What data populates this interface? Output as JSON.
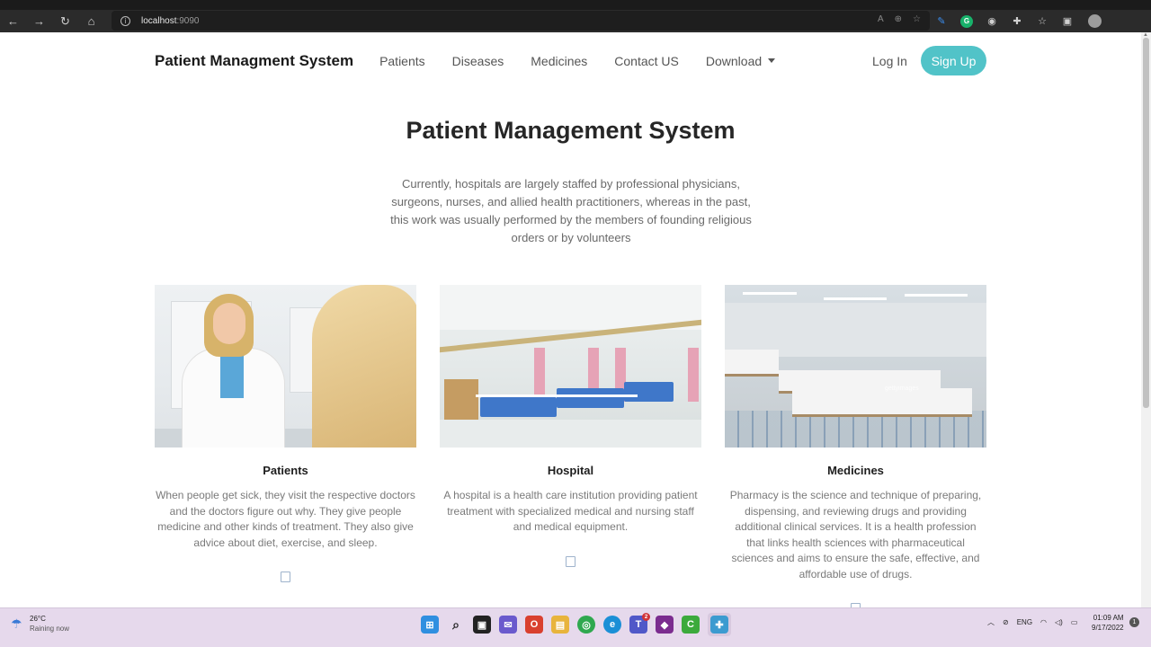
{
  "browser": {
    "url_host": "localhost",
    "url_port": ":9090"
  },
  "navbar": {
    "brand": "Patient Managment System",
    "links": [
      "Patients",
      "Diseases",
      "Medicines",
      "Contact US",
      "Download"
    ],
    "login": "Log In",
    "signup": "Sign Up"
  },
  "hero": {
    "title": "Patient Management System",
    "text": "Currently, hospitals are largely staffed by professional physicians, surgeons, nurses, and allied health practitioners, whereas in the past, this work was usually performed by the members of founding religious orders or by volunteers"
  },
  "cards": [
    {
      "title": "Patients",
      "text": "When people get sick, they visit the respective doctors and the doctors figure out why. They give people medicine and other kinds of treatment. They also give advice about diet, exercise, and sleep."
    },
    {
      "title": "Hospital",
      "text": "A hospital is a health care institution providing patient treatment with specialized medical and nursing staff and medical equipment."
    },
    {
      "title": "Medicines",
      "text": "Pharmacy is the science and technique of preparing, dispensing, and reviewing drugs and providing additional clinical services. It is a health profession that links health sciences with pharmaceutical sciences and aims to ensure the safe, effective, and affordable use of drugs."
    }
  ],
  "card3_watermark": "gettyimages",
  "taskbar": {
    "weather_temp": "26°C",
    "weather_condition": "Raining now",
    "language": "ENG",
    "time": "01:09 AM",
    "date": "9/17/2022",
    "teams_badge": "2"
  },
  "colors": {
    "signup_bg": "#51c3c8",
    "taskbar_bg": "#e6d9ec"
  }
}
